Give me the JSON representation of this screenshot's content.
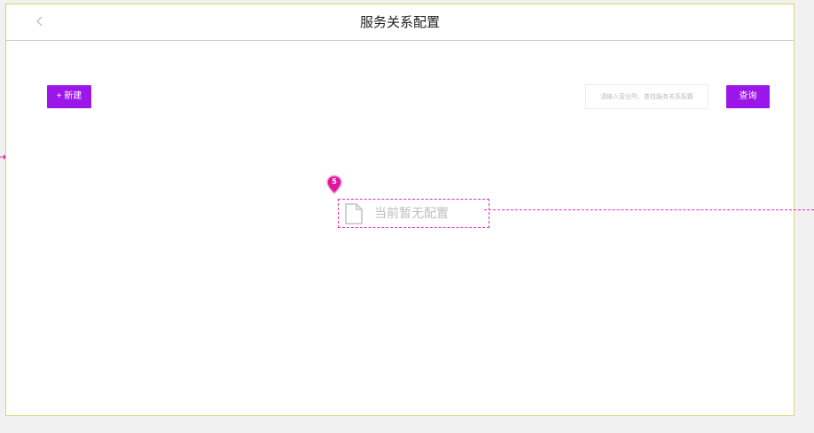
{
  "header": {
    "title": "服务关系配置",
    "back_icon": "chevron-left-icon"
  },
  "toolbar": {
    "new_label": "+ 新建",
    "search_placeholder": "请输入营业所、查找服务关系配置",
    "search_value": "",
    "query_label": "查询"
  },
  "empty_state": {
    "icon": "document-icon",
    "text": "当前暂无配置"
  },
  "annotation": {
    "marker_number": "5",
    "color": "#e62ab2"
  },
  "colors": {
    "accent": "#9b16e8",
    "frame_border": "#d9d46a",
    "annotation": "#e62ab2"
  }
}
